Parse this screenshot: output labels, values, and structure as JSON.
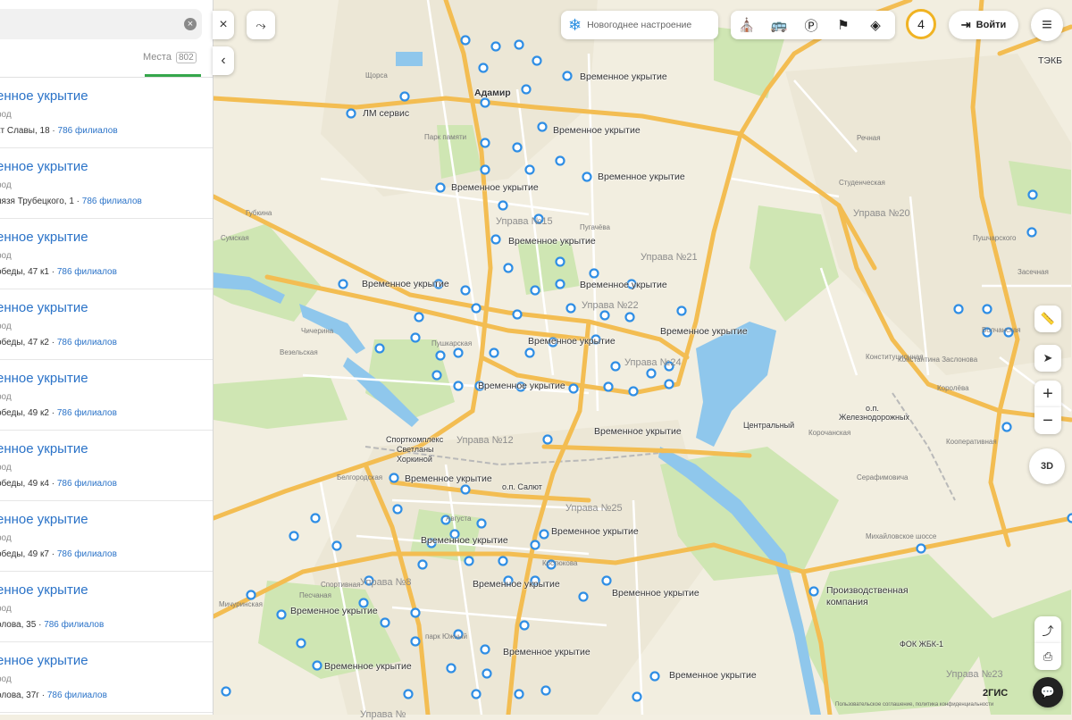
{
  "search": {
    "clear_icon": "close-circle-icon"
  },
  "tabs": {
    "places_label": "Места",
    "places_count": "802"
  },
  "results": [
    {
      "title": "енное укрытие",
      "sub": "род",
      "addr": "кт Славы, 18",
      "branches": "786 филиалов"
    },
    {
      "title": "енное укрытие",
      "sub": "род",
      "addr": "нязя Трубецкого, 1",
      "branches": "786 филиалов"
    },
    {
      "title": "енное укрытие",
      "sub": "род",
      "addr": "обеды, 47 к1",
      "branches": "786 филиалов"
    },
    {
      "title": "енное укрытие",
      "sub": "род",
      "addr": "обеды, 47 к2",
      "branches": "786 филиалов"
    },
    {
      "title": "енное укрытие",
      "sub": "род",
      "addr": "обеды, 49 к2",
      "branches": "786 филиалов"
    },
    {
      "title": "енное укрытие",
      "sub": "род",
      "addr": "обеды, 49 к4",
      "branches": "786 филиалов"
    },
    {
      "title": "енное укрытие",
      "sub": "род",
      "addr": "обеды, 49 к7",
      "branches": "786 филиалов"
    },
    {
      "title": "енное укрытие",
      "sub": "род",
      "addr": "олова, 35",
      "branches": "786 филиалов"
    },
    {
      "title": "енное укрытие",
      "sub": "род",
      "addr": "олова, 37г",
      "branches": "786 филиалов"
    }
  ],
  "separator": " · ",
  "toolbar": {
    "close": "×",
    "collapse": "‹",
    "route_icon": "route-icon",
    "newyear_label": "Новогоднее настроение",
    "newyear_icon": "snowflake-icon",
    "layers": [
      {
        "icon": "attractions-icon",
        "glyph": "⛪"
      },
      {
        "icon": "transport-icon",
        "glyph": "🚌"
      },
      {
        "icon": "parking-icon",
        "glyph": "Ⓟ"
      },
      {
        "icon": "signpost-icon",
        "glyph": "⚑"
      },
      {
        "icon": "layers-icon",
        "glyph": "◈"
      }
    ],
    "counter": "4",
    "login_label": "Войти",
    "menu": "≡"
  },
  "map_controls": {
    "zoom_in": "+",
    "zoom_out": "−",
    "mode_3d": "3D",
    "ruler": "📏",
    "locate": "➤",
    "share": "⤴",
    "print": "⎙",
    "chat": "💬"
  },
  "poi_label": "Временное укрытие",
  "places": {
    "adamir": "Адамир",
    "lm": "ЛМ сервис",
    "tekb": "ТЭКБ",
    "park": "Парк памяти",
    "sport1": "Спорткомплекс",
    "sport2": "Светланы",
    "sport3": "Хоркиной",
    "central": "Центральный",
    "salut": "о.п. Салют",
    "zhd1": "о.п.",
    "zhd2": "Железнодорожных",
    "prod1": "Производственная",
    "prod2": "компания",
    "fok": "ФОК ЖБК-1",
    "park_south": "парк Южный",
    "avgusta": "Августа",
    "kostukova": "Костюкова"
  },
  "districts": [
    "Управа №15",
    "Управа №21",
    "Управа №22",
    "Управа №24",
    "Управа №12",
    "Управа №25",
    "Управа №8",
    "Управа №20",
    "Управа №23",
    "Управа №"
  ],
  "streets": [
    "Щорса",
    "Губкина",
    "Сумская",
    "Чичерина",
    "Везельская",
    "Пушкарская",
    "Студенческая",
    "Пугачёва",
    "Речная",
    "Конституционная",
    "Засечная",
    "Волчанская",
    "Серафимовича",
    "Пушчарского",
    "Королёва",
    "Константина Заслонова",
    "Белгородская",
    "Мичуринская",
    "Песчаная",
    "Спортивная",
    "Михайловское шоссе",
    "Корочанская",
    "Кооперативная"
  ],
  "brand": "2ГИС",
  "legal": "Пользовательское соглашение, политика конфиденциальности"
}
